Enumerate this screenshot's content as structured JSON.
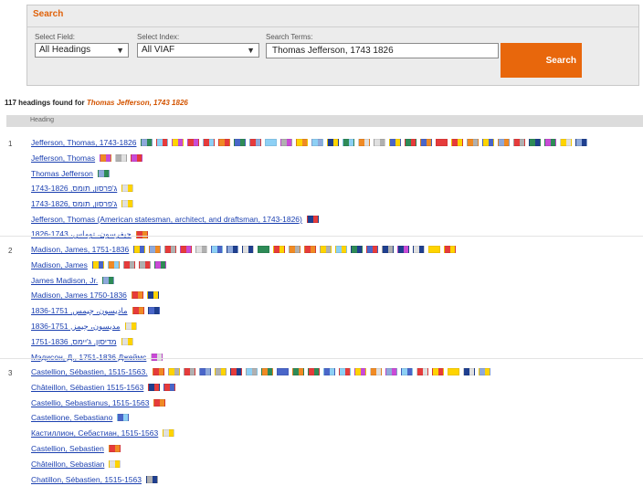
{
  "search": {
    "title": "Search",
    "field_label": "Select Field:",
    "field_value": "All Headings",
    "index_label": "Select Index:",
    "index_value": "All VIAF",
    "terms_label": "Search Terms:",
    "terms_value": "Thomas Jefferson, 1743 1826",
    "button_label": "Search"
  },
  "results": {
    "count_text": "117 headings found for",
    "query": "Thomas Jefferson, 1743 1826",
    "column_header": "Heading"
  },
  "flag_palette": [
    "#8ea9db",
    "#e63b3b",
    "#ffd400",
    "#2e8b57",
    "#f08a24",
    "#4a66c9",
    "#b0b0b0",
    "#c94bd6",
    "#8dd0f5",
    "#1f3f8f",
    "#e0e0e0"
  ],
  "rows": [
    {
      "number": "1",
      "headings": [
        {
          "text": "Jefferson, Thomas, 1743-1826",
          "flags": [
            0,
            8,
            2,
            1,
            1,
            4,
            5,
            1,
            8,
            6,
            2,
            8,
            9,
            3,
            4,
            10,
            5,
            3,
            5,
            1,
            1,
            4,
            2,
            0,
            1,
            3,
            7,
            2,
            0
          ]
        },
        {
          "text": "Jefferson, Thomas",
          "flags": [
            4,
            6,
            7
          ]
        },
        {
          "text": "Thomas Jefferson",
          "flags": [
            0
          ]
        },
        {
          "text": "ג'פרסון, תומס, 1743-1826",
          "flags": [
            10
          ]
        },
        {
          "text": "1743-1826, ג'פרסון, תומס",
          "flags": [
            10
          ]
        },
        {
          "text": "Jefferson, Thomas (American statesman, architect, and draftsman, 1743-1826)",
          "flags": [
            9
          ]
        },
        {
          "text": "جيفرسون، توماس، 1743-1826",
          "flags": [
            1
          ]
        }
      ]
    },
    {
      "number": "2",
      "headings": [
        {
          "text": "Madison, James, 1751-1836",
          "flags": [
            2,
            0,
            1,
            1,
            10,
            8,
            0,
            10,
            3,
            1,
            4,
            1,
            2,
            8,
            3,
            5,
            9,
            9,
            10,
            2,
            1
          ]
        },
        {
          "text": "Madison, James",
          "flags": [
            2,
            4,
            1,
            6,
            7
          ]
        },
        {
          "text": "James Madison, Jr.",
          "flags": [
            0
          ]
        },
        {
          "text": "Madison, James 1750-1836",
          "flags": [
            1,
            9
          ]
        },
        {
          "text": "1836-1751 ,مادیسون، جیمس",
          "flags": [
            1,
            5
          ]
        },
        {
          "text": "1836-1751 ,مديسون، جيمز",
          "flags": [
            10
          ]
        },
        {
          "text": "1751-1836 ,מדיסון, ג'יימס",
          "flags": [
            10
          ]
        },
        {
          "text": "Мэдисон, Д., 1751-1836 Джеймс",
          "flags": [
            7
          ]
        }
      ]
    },
    {
      "number": "3",
      "headings": [
        {
          "text": "Castellion, Sébastien, 1515-1563.",
          "flags": [
            1,
            2,
            1,
            5,
            6,
            1,
            8,
            4,
            5,
            3,
            1,
            5,
            8,
            2,
            4,
            0,
            8,
            1,
            2,
            2,
            9,
            0
          ]
        },
        {
          "text": "Châteillon, Sébastien 1515-1563",
          "flags": [
            9,
            1
          ]
        },
        {
          "text": "Castellio, Sebastianus, 1515-1563",
          "flags": [
            1
          ]
        },
        {
          "text": "Castellione, Sebastiano",
          "flags": [
            5
          ]
        },
        {
          "text": "Кастиллион, Себастиан, 1515-1563",
          "flags": [
            10
          ]
        },
        {
          "text": "Castellion, Sebastien",
          "flags": [
            1
          ]
        },
        {
          "text": "Châteillon, Sebastian",
          "flags": [
            10
          ]
        },
        {
          "text": "Chatillon, Sébastien, 1515-1563",
          "flags": [
            6
          ]
        }
      ]
    }
  ]
}
